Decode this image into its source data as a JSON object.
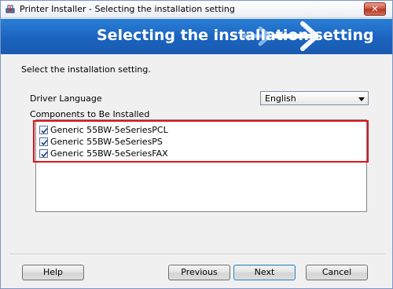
{
  "window": {
    "title": "Printer Installer - Selecting the installation setting",
    "close_label": "✕"
  },
  "banner": {
    "title": "Selecting the installation setting"
  },
  "main": {
    "instruction": "Select the installation setting.",
    "driver_language_label": "Driver Language",
    "driver_language_value": "English",
    "components_label": "Components to Be Installed",
    "components": [
      {
        "label": "Generic 55BW-5eSeriesPCL",
        "checked": true
      },
      {
        "label": "Generic 55BW-5eSeriesPS",
        "checked": true
      },
      {
        "label": "Generic 55BW-5eSeriesFAX",
        "checked": true
      }
    ]
  },
  "buttons": {
    "help": "Help",
    "previous": "Previous",
    "next": "Next",
    "cancel": "Cancel"
  },
  "colors": {
    "banner": "#1b63be",
    "highlight": "#e0121a"
  },
  "icons": {
    "app": "printer-install-icon",
    "banner": "forward-arrows-icon",
    "dropdown": "chevron-down-icon",
    "check": "check-icon"
  }
}
